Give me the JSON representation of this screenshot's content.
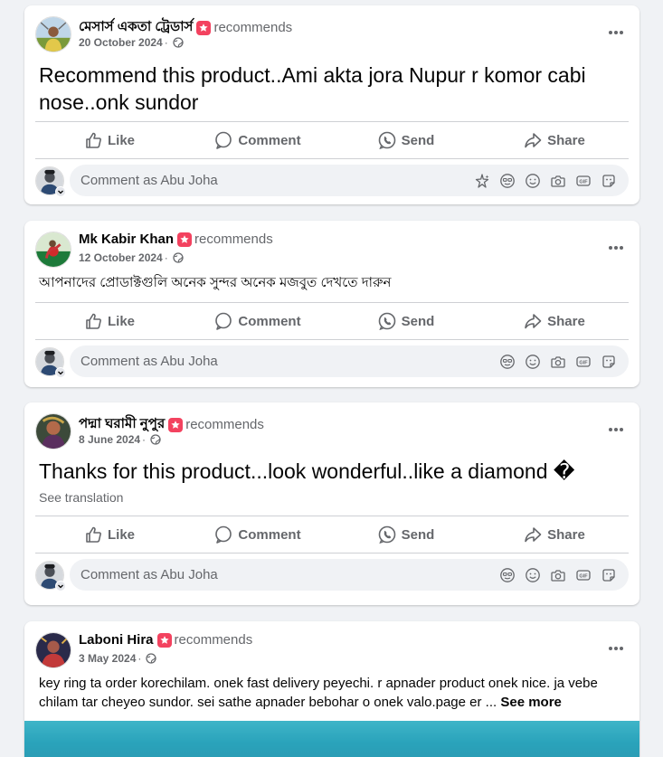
{
  "viewer": {
    "comment_placeholder": "Comment as Abu Joha"
  },
  "actions": {
    "like": "Like",
    "comment": "Comment",
    "send": "Send",
    "share": "Share"
  },
  "posts": [
    {
      "author": "মেসার্স একতা ট্রেডার্স",
      "verb": "recommends",
      "date": "20 October 2024",
      "sep": "·",
      "text": "Recommend this product..Ami akta jora Nupur r komor cabi nose..onk sundor"
    },
    {
      "author": "Mk Kabir Khan",
      "verb": "recommends",
      "date": "12 October 2024",
      "sep": "·",
      "text": "আপনাদের প্রোডাক্টগুলি অনেক সুন্দর অনেক মজবুত  দেখতে দারুন"
    },
    {
      "author": "পদ্মা ঘরামী নুপুর",
      "verb": "recommends",
      "date": "8 June 2024",
      "sep": "·",
      "text": "Thanks for this product...look wonderful..like a diamond �",
      "see_translation": "See translation"
    },
    {
      "author": "Laboni Hira",
      "verb": "recommends",
      "date": "3 May 2024",
      "sep": "·",
      "text": "key ring ta order korechilam. onek fast delivery peyechi. r apnader product  onek nice. ja vebe chilam tar cheyeo sundor. sei sathe apnader bebohar o onek valo.page er ...",
      "see_more": "See more"
    }
  ]
}
